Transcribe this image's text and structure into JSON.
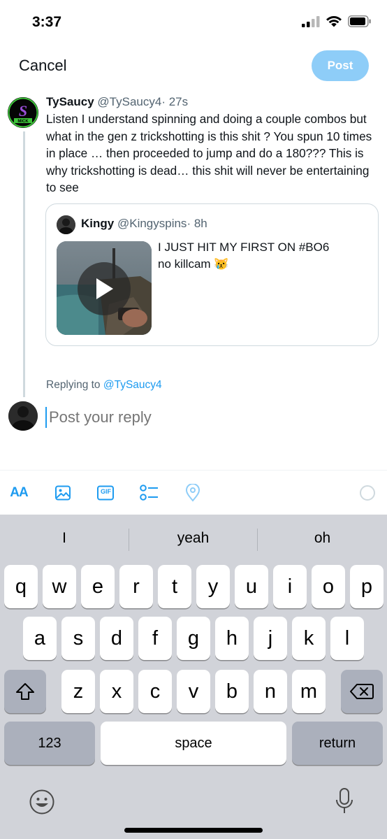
{
  "status_bar": {
    "time": "3:37"
  },
  "nav": {
    "cancel_label": "Cancel",
    "post_label": "Post"
  },
  "tweet": {
    "name": "TySaucy",
    "handle": "@TySaucy4",
    "time": "· 27s",
    "text": "Listen I understand spinning and doing a couple combos but what in the gen z trickshotting is this shit ? You spun 10 times in place … then proceeded to jump and do a 180??? This is why trickshotting is dead… this shit will never be entertaining to see"
  },
  "quote": {
    "name": "Kingy",
    "handle": "@Kingyspins",
    "time": "· 8h",
    "line1": "I JUST HIT MY FIRST ON #BO6",
    "line2": "no killcam 😿"
  },
  "reply": {
    "replying_prefix": "Replying to",
    "replying_to": "@TySaucy4",
    "placeholder": "Post your reply"
  },
  "toolbar": {
    "items": [
      "text-size-icon",
      "image-icon",
      "gif-icon",
      "poll-icon",
      "location-icon",
      "char-count-ring-icon"
    ],
    "text_size_label": "AA",
    "gif_label": "GIF"
  },
  "keyboard": {
    "suggestions": [
      "I",
      "yeah",
      "oh"
    ],
    "row1": [
      "q",
      "w",
      "e",
      "r",
      "t",
      "y",
      "u",
      "i",
      "o",
      "p"
    ],
    "row2": [
      "a",
      "s",
      "d",
      "f",
      "g",
      "h",
      "j",
      "k",
      "l"
    ],
    "row3": [
      "z",
      "x",
      "c",
      "v",
      "b",
      "n",
      "m"
    ],
    "numbers_label": "123",
    "space_label": "space",
    "return_label": "return"
  },
  "colors": {
    "accent": "#1d9bf0",
    "post_button_disabled": "#8ecdf8",
    "keyboard_bg": "#d1d3d9"
  }
}
